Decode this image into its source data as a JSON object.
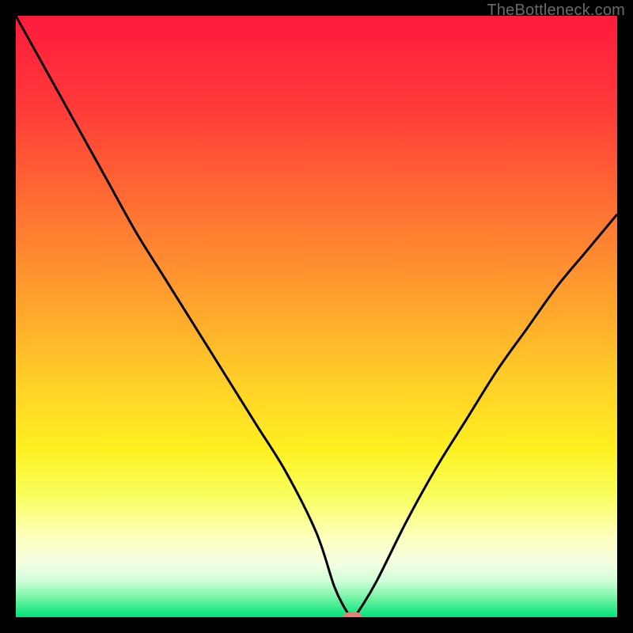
{
  "watermark": "TheBottleneck.com",
  "chart_data": {
    "type": "line",
    "title": "",
    "xlabel": "",
    "ylabel": "",
    "xlim": [
      0,
      100
    ],
    "ylim": [
      0,
      100
    ],
    "grid": false,
    "legend": false,
    "series": [
      {
        "name": "bottleneck-curve",
        "x": [
          0,
          5,
          10,
          15,
          20,
          25,
          30,
          35,
          40,
          45,
          50,
          53,
          55,
          56,
          57,
          60,
          65,
          70,
          75,
          80,
          85,
          90,
          95,
          100
        ],
        "y": [
          100,
          91,
          82,
          73,
          64,
          56,
          48,
          40,
          32,
          24,
          14,
          5,
          1,
          0,
          1,
          6,
          16,
          25,
          33,
          41,
          48,
          55,
          61,
          67
        ]
      }
    ],
    "marker": {
      "x": 56,
      "y": 0
    },
    "gradient_stops": [
      {
        "offset": 0.0,
        "color": "#ff1a3c"
      },
      {
        "offset": 0.15,
        "color": "#ff3a3a"
      },
      {
        "offset": 0.3,
        "color": "#ff6a33"
      },
      {
        "offset": 0.45,
        "color": "#ff9a2e"
      },
      {
        "offset": 0.6,
        "color": "#ffcc28"
      },
      {
        "offset": 0.72,
        "color": "#fff021"
      },
      {
        "offset": 0.8,
        "color": "#f8ff60"
      },
      {
        "offset": 0.87,
        "color": "#fdffc0"
      },
      {
        "offset": 0.91,
        "color": "#f4ffe2"
      },
      {
        "offset": 0.94,
        "color": "#cfffd8"
      },
      {
        "offset": 0.965,
        "color": "#7ef5a8"
      },
      {
        "offset": 1.0,
        "color": "#00e27a"
      }
    ],
    "marker_color": "#e87f74",
    "curve_color": "#000000"
  }
}
